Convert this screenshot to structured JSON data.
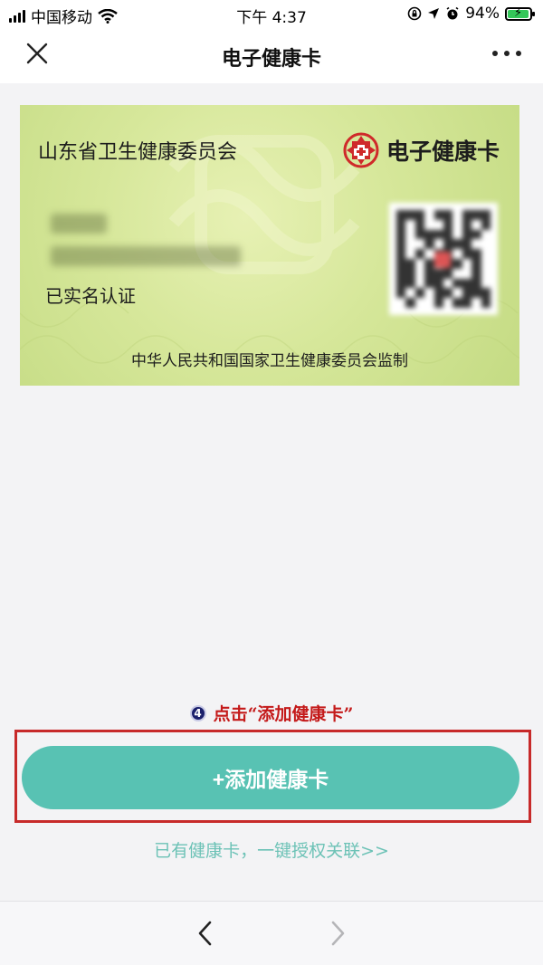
{
  "status_bar": {
    "carrier": "中国移动",
    "time": "下午 4:37",
    "battery": "94%",
    "battery_level": 0.94,
    "icons": [
      "signal-icon",
      "wifi-icon",
      "screen-lock-icon",
      "location-icon",
      "alarm-icon",
      "battery-charging-icon"
    ]
  },
  "nav": {
    "title": "电子健康卡",
    "close_icon": "close-icon",
    "more_icon": "more-icon"
  },
  "card": {
    "issuer": "山东省卫生健康委员会",
    "brand": "电子健康卡",
    "status": "已实名认证",
    "footer": "中华人民共和国国家卫生健康委员会监制"
  },
  "annotation": {
    "step": "4",
    "text": "点击“添加健康卡”"
  },
  "actions": {
    "add_card": "+添加健康卡",
    "link_existing": "已有健康卡，一键授权关联>>"
  },
  "toolbar": {
    "back_icon": "chevron-left-icon",
    "forward_icon": "chevron-right-icon"
  },
  "colors": {
    "accent": "#58c2b3",
    "link": "#6cc2b6",
    "highlight": "#c72a2a",
    "card_bg": "#d6e79a"
  }
}
